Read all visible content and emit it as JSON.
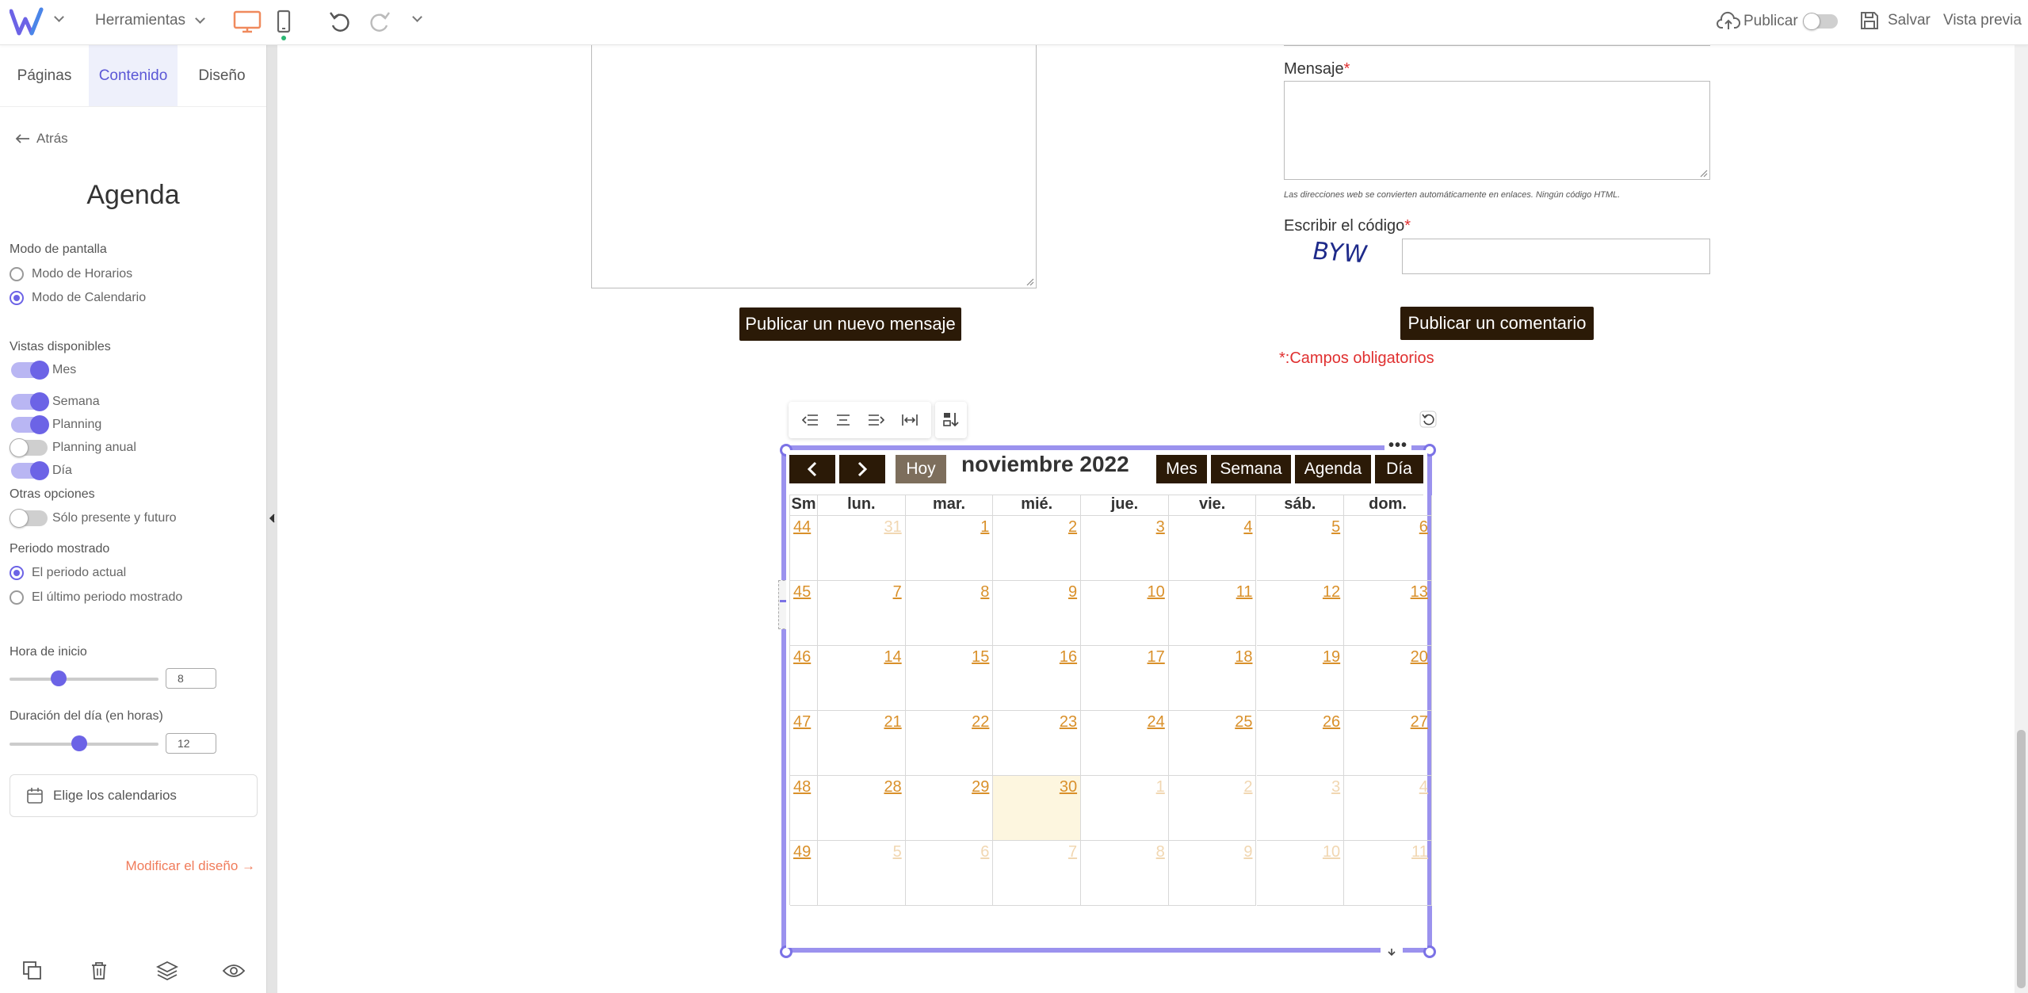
{
  "topbar": {
    "tools_label": "Herramientas",
    "publish_label": "Publicar",
    "save_label": "Salvar",
    "preview_label": "Vista previa"
  },
  "panel": {
    "tabs": [
      "Páginas",
      "Contenido",
      "Diseño"
    ],
    "back_label": "Atrás",
    "title": "Agenda",
    "display_mode": {
      "heading": "Modo de pantalla",
      "options": [
        {
          "label": "Modo de Horarios",
          "selected": false
        },
        {
          "label": "Modo de Calendario",
          "selected": true
        }
      ]
    },
    "views": {
      "heading": "Vistas disponibles",
      "items": [
        {
          "label": "Mes",
          "on": true
        },
        {
          "label": "Semana",
          "on": true
        },
        {
          "label": "Planning",
          "on": true
        },
        {
          "label": "Planning anual",
          "on": false
        },
        {
          "label": "Día",
          "on": true
        }
      ]
    },
    "other": {
      "heading": "Otras opciones",
      "items": [
        {
          "label": "Sólo presente y futuro",
          "on": false
        }
      ]
    },
    "period": {
      "heading": "Periodo mostrado",
      "options": [
        {
          "label": "El periodo actual",
          "selected": true
        },
        {
          "label": "El último periodo mostrado",
          "selected": false
        }
      ]
    },
    "start_hour": {
      "label": "Hora de inicio",
      "value": "8",
      "level": 0.33
    },
    "day_length": {
      "label": "Duración del día (en horas)",
      "value": "12",
      "level": 0.47
    },
    "choose_calendars": "Elige los calendarios",
    "modify_design": "Modificar el diseño →"
  },
  "form": {
    "publish_message_btn": "Publicar un nuevo mensaje",
    "message_label": "Mensaje",
    "required_mark": "*",
    "html_note": "Las direcciones web se convierten automáticamente en enlaces. Ningún código HTML.",
    "captcha_label": "Escribir el código",
    "captcha_text": "BYW",
    "publish_comment_btn": "Publicar un comentario",
    "required_note": "*:Campos obligatorios"
  },
  "calendar": {
    "nav_prev": "<",
    "nav_next": ">",
    "today": "Hoy",
    "title": "noviembre 2022",
    "views": [
      "Mes",
      "Semana",
      "Agenda",
      "Día"
    ],
    "week_col": "Sm",
    "days": [
      "lun.",
      "mar.",
      "mié.",
      "jue.",
      "vie.",
      "sáb.",
      "dom."
    ],
    "weeks": [
      {
        "num": "44",
        "days": [
          {
            "d": "31",
            "o": true
          },
          {
            "d": "1"
          },
          {
            "d": "2"
          },
          {
            "d": "3"
          },
          {
            "d": "4"
          },
          {
            "d": "5"
          },
          {
            "d": "6"
          }
        ]
      },
      {
        "num": "45",
        "days": [
          {
            "d": "7"
          },
          {
            "d": "8"
          },
          {
            "d": "9"
          },
          {
            "d": "10"
          },
          {
            "d": "11"
          },
          {
            "d": "12"
          },
          {
            "d": "13"
          }
        ]
      },
      {
        "num": "46",
        "days": [
          {
            "d": "14"
          },
          {
            "d": "15"
          },
          {
            "d": "16"
          },
          {
            "d": "17"
          },
          {
            "d": "18"
          },
          {
            "d": "19"
          },
          {
            "d": "20"
          }
        ]
      },
      {
        "num": "47",
        "days": [
          {
            "d": "21"
          },
          {
            "d": "22"
          },
          {
            "d": "23"
          },
          {
            "d": "24"
          },
          {
            "d": "25"
          },
          {
            "d": "26"
          },
          {
            "d": "27"
          }
        ]
      },
      {
        "num": "48",
        "days": [
          {
            "d": "28"
          },
          {
            "d": "29"
          },
          {
            "d": "30",
            "today": true
          },
          {
            "d": "1",
            "o": true
          },
          {
            "d": "2",
            "o": true
          },
          {
            "d": "3",
            "o": true
          },
          {
            "d": "4",
            "o": true
          }
        ]
      },
      {
        "num": "49",
        "days": [
          {
            "d": "5",
            "o": true
          },
          {
            "d": "6",
            "o": true
          },
          {
            "d": "7",
            "o": true
          },
          {
            "d": "8",
            "o": true
          },
          {
            "d": "9",
            "o": true
          },
          {
            "d": "10",
            "o": true
          },
          {
            "d": "11",
            "o": true
          }
        ]
      }
    ]
  },
  "colors": {
    "accent": "#6c63e6",
    "dark_button": "#2b1a07",
    "date_link": "#d9902a",
    "other_month": "#f1d7b2",
    "today_bg": "#fdf6df",
    "design_link": "#f07b5a",
    "device_active": "#f08a5d"
  }
}
